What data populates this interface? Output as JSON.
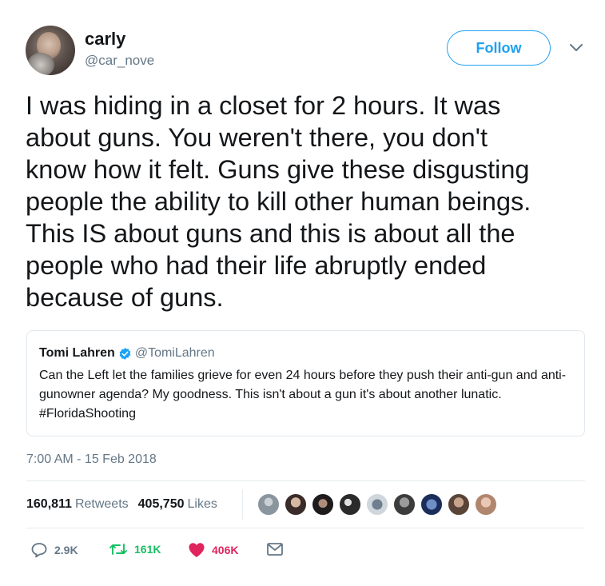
{
  "author": {
    "name": "carly",
    "handle": "@car_nove",
    "follow_label": "Follow"
  },
  "tweet": {
    "text": "I was hiding in a closet for 2 hours. It was\nabout guns. You weren't there, you don't\nknow how it felt. Guns give these disgusting\npeople the ability to kill other human beings.\nThis IS about guns and this is about all the\npeople who had their life abruptly ended\nbecause of guns.",
    "timestamp": "7:00 AM - 15 Feb 2018"
  },
  "quoted": {
    "name": "Tomi Lahren",
    "handle": "@TomiLahren",
    "text": "Can the Left let the families grieve for even 24 hours before they push their anti-gun and anti-gunowner agenda? My goodness. This isn't about a gun it's about another lunatic. #FloridaShooting"
  },
  "stats": {
    "retweets_count": "160,811",
    "retweets_label": "Retweets",
    "likes_count": "405,750",
    "likes_label": "Likes"
  },
  "actions": {
    "replies": "2.9K",
    "retweets": "161K",
    "likes": "406K"
  },
  "colors": {
    "brand": "#1da1f2",
    "retweet": "#17bf63",
    "like": "#e0245e",
    "muted": "#657786"
  },
  "icons": [
    "chevron-down-icon",
    "verified-badge-icon",
    "reply-icon",
    "retweet-icon",
    "heart-icon",
    "envelope-icon"
  ]
}
